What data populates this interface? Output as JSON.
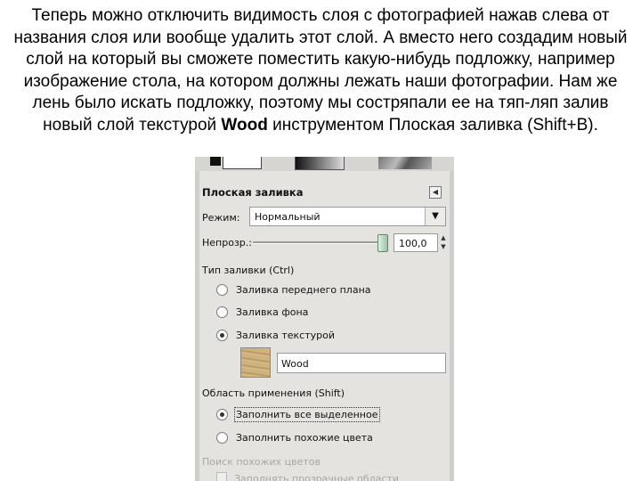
{
  "caption": {
    "text_1": "Теперь можно отключить видимость слоя с фотографией нажав слева от названия слоя или вообще удалить этот слой. А вместо него создадим новый слой на который вы сможете поместить какую-нибудь подложку, например изображение стола, на котором должны лежать наши фотографии. Нам же лень было искать подложку, поэтому мы состряпали ее на тяп-ляп залив новый слой текстурой ",
    "bold": "Wood",
    "text_2": " инструментом Плоская заливка    (Shift+B)."
  },
  "panel": {
    "title": "Плоская заливка",
    "mode_label": "Режим:",
    "mode_value": "Нормальный",
    "opacity_label": "Непрозр.:",
    "opacity_value": "100,0",
    "fill_type_label": "Тип заливки (Ctrl)",
    "fill_options": [
      "Заливка переднего плана",
      "Заливка фона",
      "Заливка текстурой"
    ],
    "fill_selected_index": 2,
    "pattern_name": "Wood",
    "affected_area_label": "Область применения (Shift)",
    "area_options": [
      "Заполнить все выделенное",
      "Заполнить похожие цвета"
    ],
    "area_selected_index": 0,
    "similar_colors_label": "Поиск похожих цветов",
    "partial_option": "Заполнять прозрачные области"
  },
  "icons": {
    "collapse": "collapse-left-icon",
    "dropdown": "chevron-down-icon",
    "spin": "spin-arrows-icon"
  }
}
